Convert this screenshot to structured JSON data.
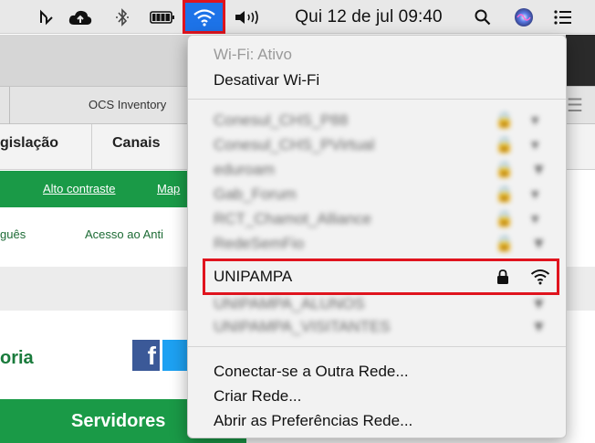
{
  "menubar": {
    "clock": "Qui 12 de jul  09:40",
    "icons": [
      "cursor-icon",
      "cloud-upload-icon",
      "bluetooth-icon",
      "battery-icon",
      "wifi-icon",
      "volume-icon",
      "search-icon",
      "siri-icon",
      "list-icon"
    ]
  },
  "background_page": {
    "tab_label": "OCS Inventory",
    "nav_tabs": [
      "gislação",
      "Canais"
    ],
    "green_bar_links": [
      "Alto contraste",
      "Map"
    ],
    "links": [
      "guês",
      "Acesso ao Anti"
    ],
    "heading": "oria",
    "servidores_button": "Servidores"
  },
  "wifi_menu": {
    "status": "Wi-Fi: Ativo",
    "toggle": "Desativar Wi-Fi",
    "networks_blurred": [
      "Conesul_CHS_P88",
      "Conesul_CHS_PVirtual",
      "eduroam",
      "Gab_Forum",
      "RCT_Chamot_Alliance",
      "RedeSemFio",
      "UNIPAMPA_ALUNOS",
      "UNIPAMPA_VISITANTES"
    ],
    "selected_network": "UNIPAMPA",
    "actions": [
      "Conectar-se a Outra Rede...",
      "Criar Rede...",
      "Abrir as Preferências Rede..."
    ]
  },
  "colors": {
    "highlight": "#e0141e",
    "wifi_active": "#1d73e8",
    "brand_green": "#1a9a47"
  }
}
